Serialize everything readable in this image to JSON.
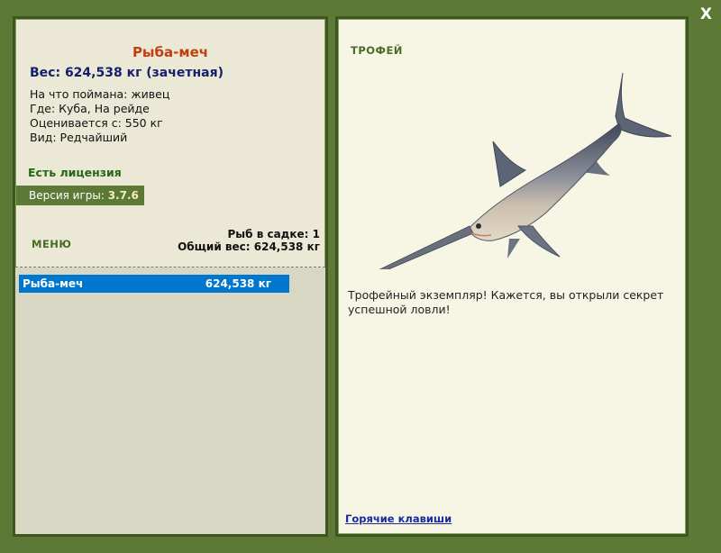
{
  "close_label": "X",
  "left": {
    "fish_name": "Рыба-меч",
    "fish_weight": "Вес: 624,538 кг (зачетная)",
    "info_lines": [
      "На что поймана: живец",
      "Где: Куба, На рейде",
      "Оценивается с: 550 кг",
      "Вид: Редчайший"
    ],
    "license": "Есть лицензия",
    "version_prefix": "Версия игры: ",
    "version": "3.7.6",
    "menu_label": "МЕНЮ",
    "fish_count": "Рыб в садке: 1",
    "total_weight": "Общий вес: 624,538 кг",
    "list": [
      {
        "name": "Рыба-меч",
        "weight": "624,538 кг"
      }
    ]
  },
  "right": {
    "trophy_title": "ТРОФЕЙ",
    "fish_image_icon": "swordfish-image",
    "description": "Трофейный экземпляр! Кажется, вы открыли секрет успешной ловли!",
    "hotkeys_link": "Горячие клавиши"
  },
  "colors": {
    "frame": "#5c7a36",
    "accent_name": "#c03e10",
    "weight_text": "#14206e",
    "selected_row": "#0077cf",
    "link": "#1a2b9c"
  }
}
